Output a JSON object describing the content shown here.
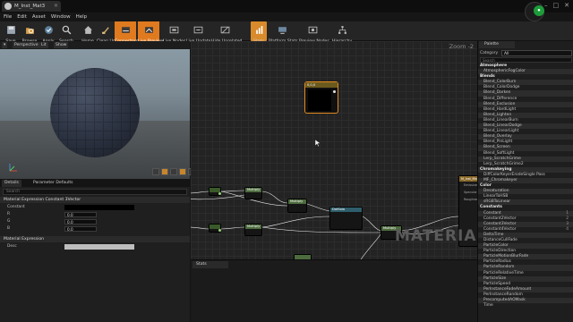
{
  "window": {
    "tab_title": "M_Inst_Mat3"
  },
  "menu": [
    "File",
    "Edit",
    "Asset",
    "Window",
    "Help"
  ],
  "toolbar": [
    {
      "label": "Save"
    },
    {
      "label": "Browse"
    },
    {
      "label": "Apply"
    },
    {
      "label": "Search"
    },
    {
      "label": "Home"
    },
    {
      "label": "Clean Up"
    },
    {
      "label": "Connectors"
    },
    {
      "label": "Live Preview"
    },
    {
      "label": "Live Nodes"
    },
    {
      "label": "Live Update"
    },
    {
      "label": "Hide Unrelated"
    },
    {
      "label": "Stats"
    },
    {
      "label": "Platform Stats"
    },
    {
      "label": "Preview Nodes"
    },
    {
      "label": "Hierarchy"
    }
  ],
  "viewport": {
    "tabs": [
      "Perspective",
      "Lit",
      "Show"
    ]
  },
  "details": {
    "tabs": [
      "Details",
      "Parameter Defaults"
    ],
    "search_placeholder": "Search",
    "section1": "Material Expression Constant 3Vector",
    "constant_label": "Constant",
    "rows": [
      {
        "key": "R",
        "value": "0.0"
      },
      {
        "key": "G",
        "value": "0.0"
      },
      {
        "key": "B",
        "value": "0.0"
      }
    ],
    "section2": "Material Expression",
    "desc_label": "Desc"
  },
  "graph": {
    "zoom": "Zoom -2",
    "watermark": "MATERIAL",
    "nodes": {
      "const3": "0,0,0",
      "mult1": "Multiply",
      "mult2": "Multiply",
      "mult3": "Multiply",
      "mult4": "Multiply",
      "dot": "DotSolo",
      "res": "M_Inst_Mat"
    },
    "res_pins": [
      "Emissive",
      "Specular",
      "Roughness"
    ]
  },
  "stats": {
    "tab": "Stats"
  },
  "palette": {
    "tab": "Palette",
    "category_label": "Category",
    "category_value": "All",
    "search_placeholder": "Search",
    "items": [
      {
        "t": "Atmosphere",
        "c": true
      },
      {
        "t": "AtmosphericFogColor"
      },
      {
        "t": "Blends",
        "c": true
      },
      {
        "t": "Blend_ColorBurn"
      },
      {
        "t": "Blend_ColorDodge"
      },
      {
        "t": "Blend_Darken"
      },
      {
        "t": "Blend_Difference"
      },
      {
        "t": "Blend_Exclusion"
      },
      {
        "t": "Blend_HardLight"
      },
      {
        "t": "Blend_Lighten"
      },
      {
        "t": "Blend_LinearBurn"
      },
      {
        "t": "Blend_LinearDodge"
      },
      {
        "t": "Blend_LinearLight"
      },
      {
        "t": "Blend_Overlay"
      },
      {
        "t": "Blend_PinLight"
      },
      {
        "t": "Blend_Screen"
      },
      {
        "t": "Blend_SoftLight"
      },
      {
        "t": "Lerp_ScratchGrime"
      },
      {
        "t": "Lerp_ScratchGrime2"
      },
      {
        "t": "Chromakeying",
        "c": true
      },
      {
        "t": "DiffColorKeyerErodeSingle Pass"
      },
      {
        "t": "MF_Chromakeyer"
      },
      {
        "t": "Color",
        "c": true
      },
      {
        "t": "Desaturation"
      },
      {
        "t": "LinearToHSB"
      },
      {
        "t": "sRGBToLinear"
      },
      {
        "t": "Constants",
        "c": true
      },
      {
        "t": "Constant",
        "n": "1"
      },
      {
        "t": "Constant2Vector",
        "n": "2"
      },
      {
        "t": "Constant3Vector",
        "n": "3"
      },
      {
        "t": "Constant4Vector",
        "n": "4"
      },
      {
        "t": "DeltaTime"
      },
      {
        "t": "DistanceCullFade"
      },
      {
        "t": "ParticleColor"
      },
      {
        "t": "ParticleDirection"
      },
      {
        "t": "ParticleMotionBlurFade"
      },
      {
        "t": "ParticleRadius"
      },
      {
        "t": "ParticleRandom"
      },
      {
        "t": "ParticleRelativeTime"
      },
      {
        "t": "ParticleSize"
      },
      {
        "t": "ParticleSpeed"
      },
      {
        "t": "PerInstanceFadeAmount"
      },
      {
        "t": "PerInstanceRandom"
      },
      {
        "t": "PrecomputedAOMask"
      },
      {
        "t": "Time"
      }
    ]
  }
}
